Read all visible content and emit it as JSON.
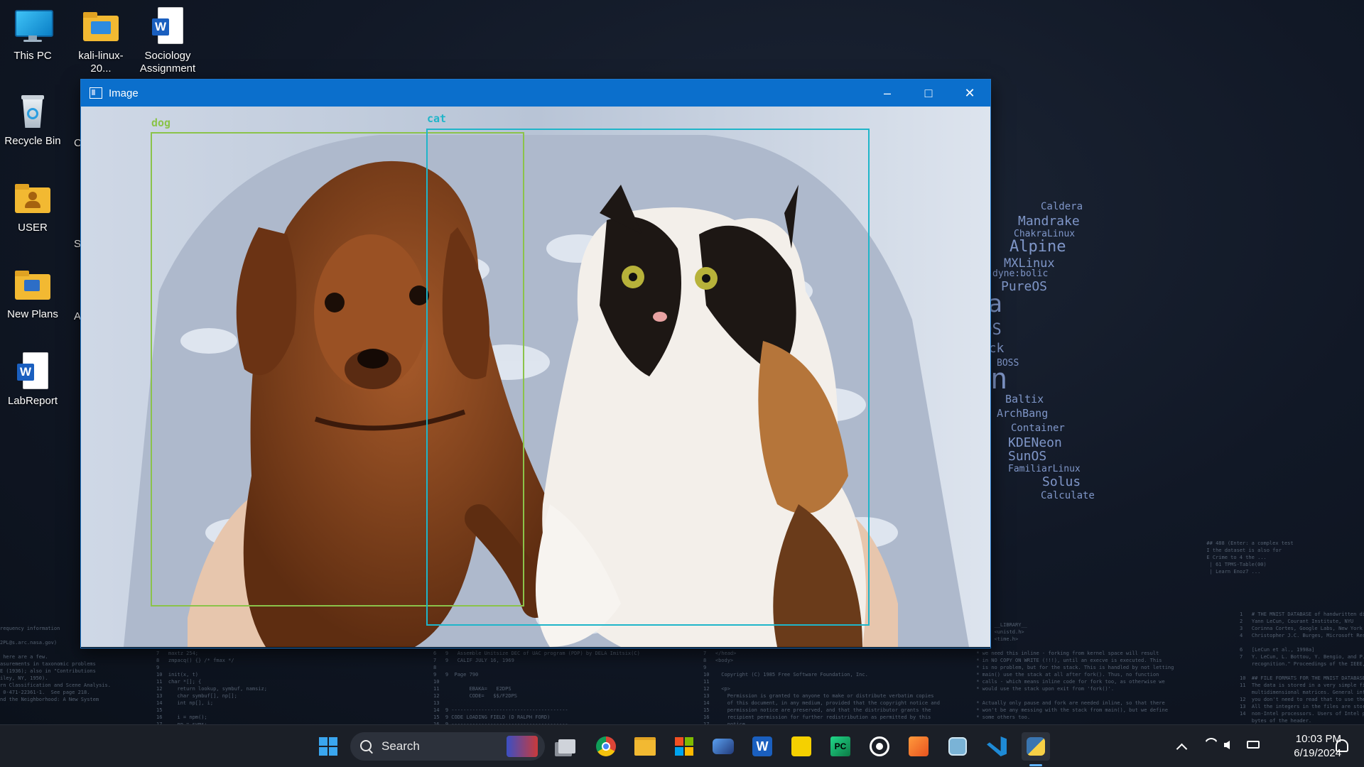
{
  "desktop": {
    "icons": [
      {
        "label": "This PC",
        "icon": "monitor-icon"
      },
      {
        "label": "kali-linux-20...",
        "icon": "folder-mail-icon"
      },
      {
        "label": "Sociology Assignment",
        "icon": "word-document-icon"
      },
      {
        "label": "Recycle Bin",
        "icon": "recycle-bin-icon"
      },
      {
        "label": "USER",
        "icon": "user-folder-icon"
      },
      {
        "label": "New Plans",
        "icon": "folder-icon"
      },
      {
        "label": "LabReport",
        "icon": "word-document-icon"
      }
    ],
    "clipped_labels": [
      "C",
      "S",
      "A"
    ]
  },
  "window": {
    "title": "Image",
    "minimize": "–",
    "maximize": "□",
    "close": "✕",
    "detections": [
      {
        "label": "dog",
        "color": "#8bc34a"
      },
      {
        "label": "cat",
        "color": "#1fb5c9"
      }
    ]
  },
  "wallpaper": {
    "wordcloud": [
      "Caldera",
      "Mandrake",
      "ChakraLinux",
      "Alpine",
      "MXLinux",
      "dyne:bolic",
      "PureOS",
      "ra",
      "mOS",
      "rack",
      "BOSS",
      "an",
      "Baltix",
      "ArchBang",
      "Container",
      "KDENeon",
      "SunOS",
      "FamiliarLinux",
      "Solus",
      "Calculate"
    ]
  },
  "taskbar": {
    "search_label": "Search",
    "apps": [
      "task-view-icon",
      "chrome-icon",
      "file-explorer-icon",
      "store-icon",
      "game-icon",
      "word-icon",
      "player-icon",
      "pycharm-icon",
      "whatsapp-icon",
      "reader-icon",
      "settings-app-icon",
      "vscode-icon",
      "python-icon"
    ],
    "time": "10:03 PM",
    "date": "6/19/2024"
  },
  "colors": {
    "titlebar": "#0b6fcc",
    "taskbar": "#1b1f27",
    "dog_box": "#8bc34a",
    "cat_box": "#1fb5c9"
  }
}
